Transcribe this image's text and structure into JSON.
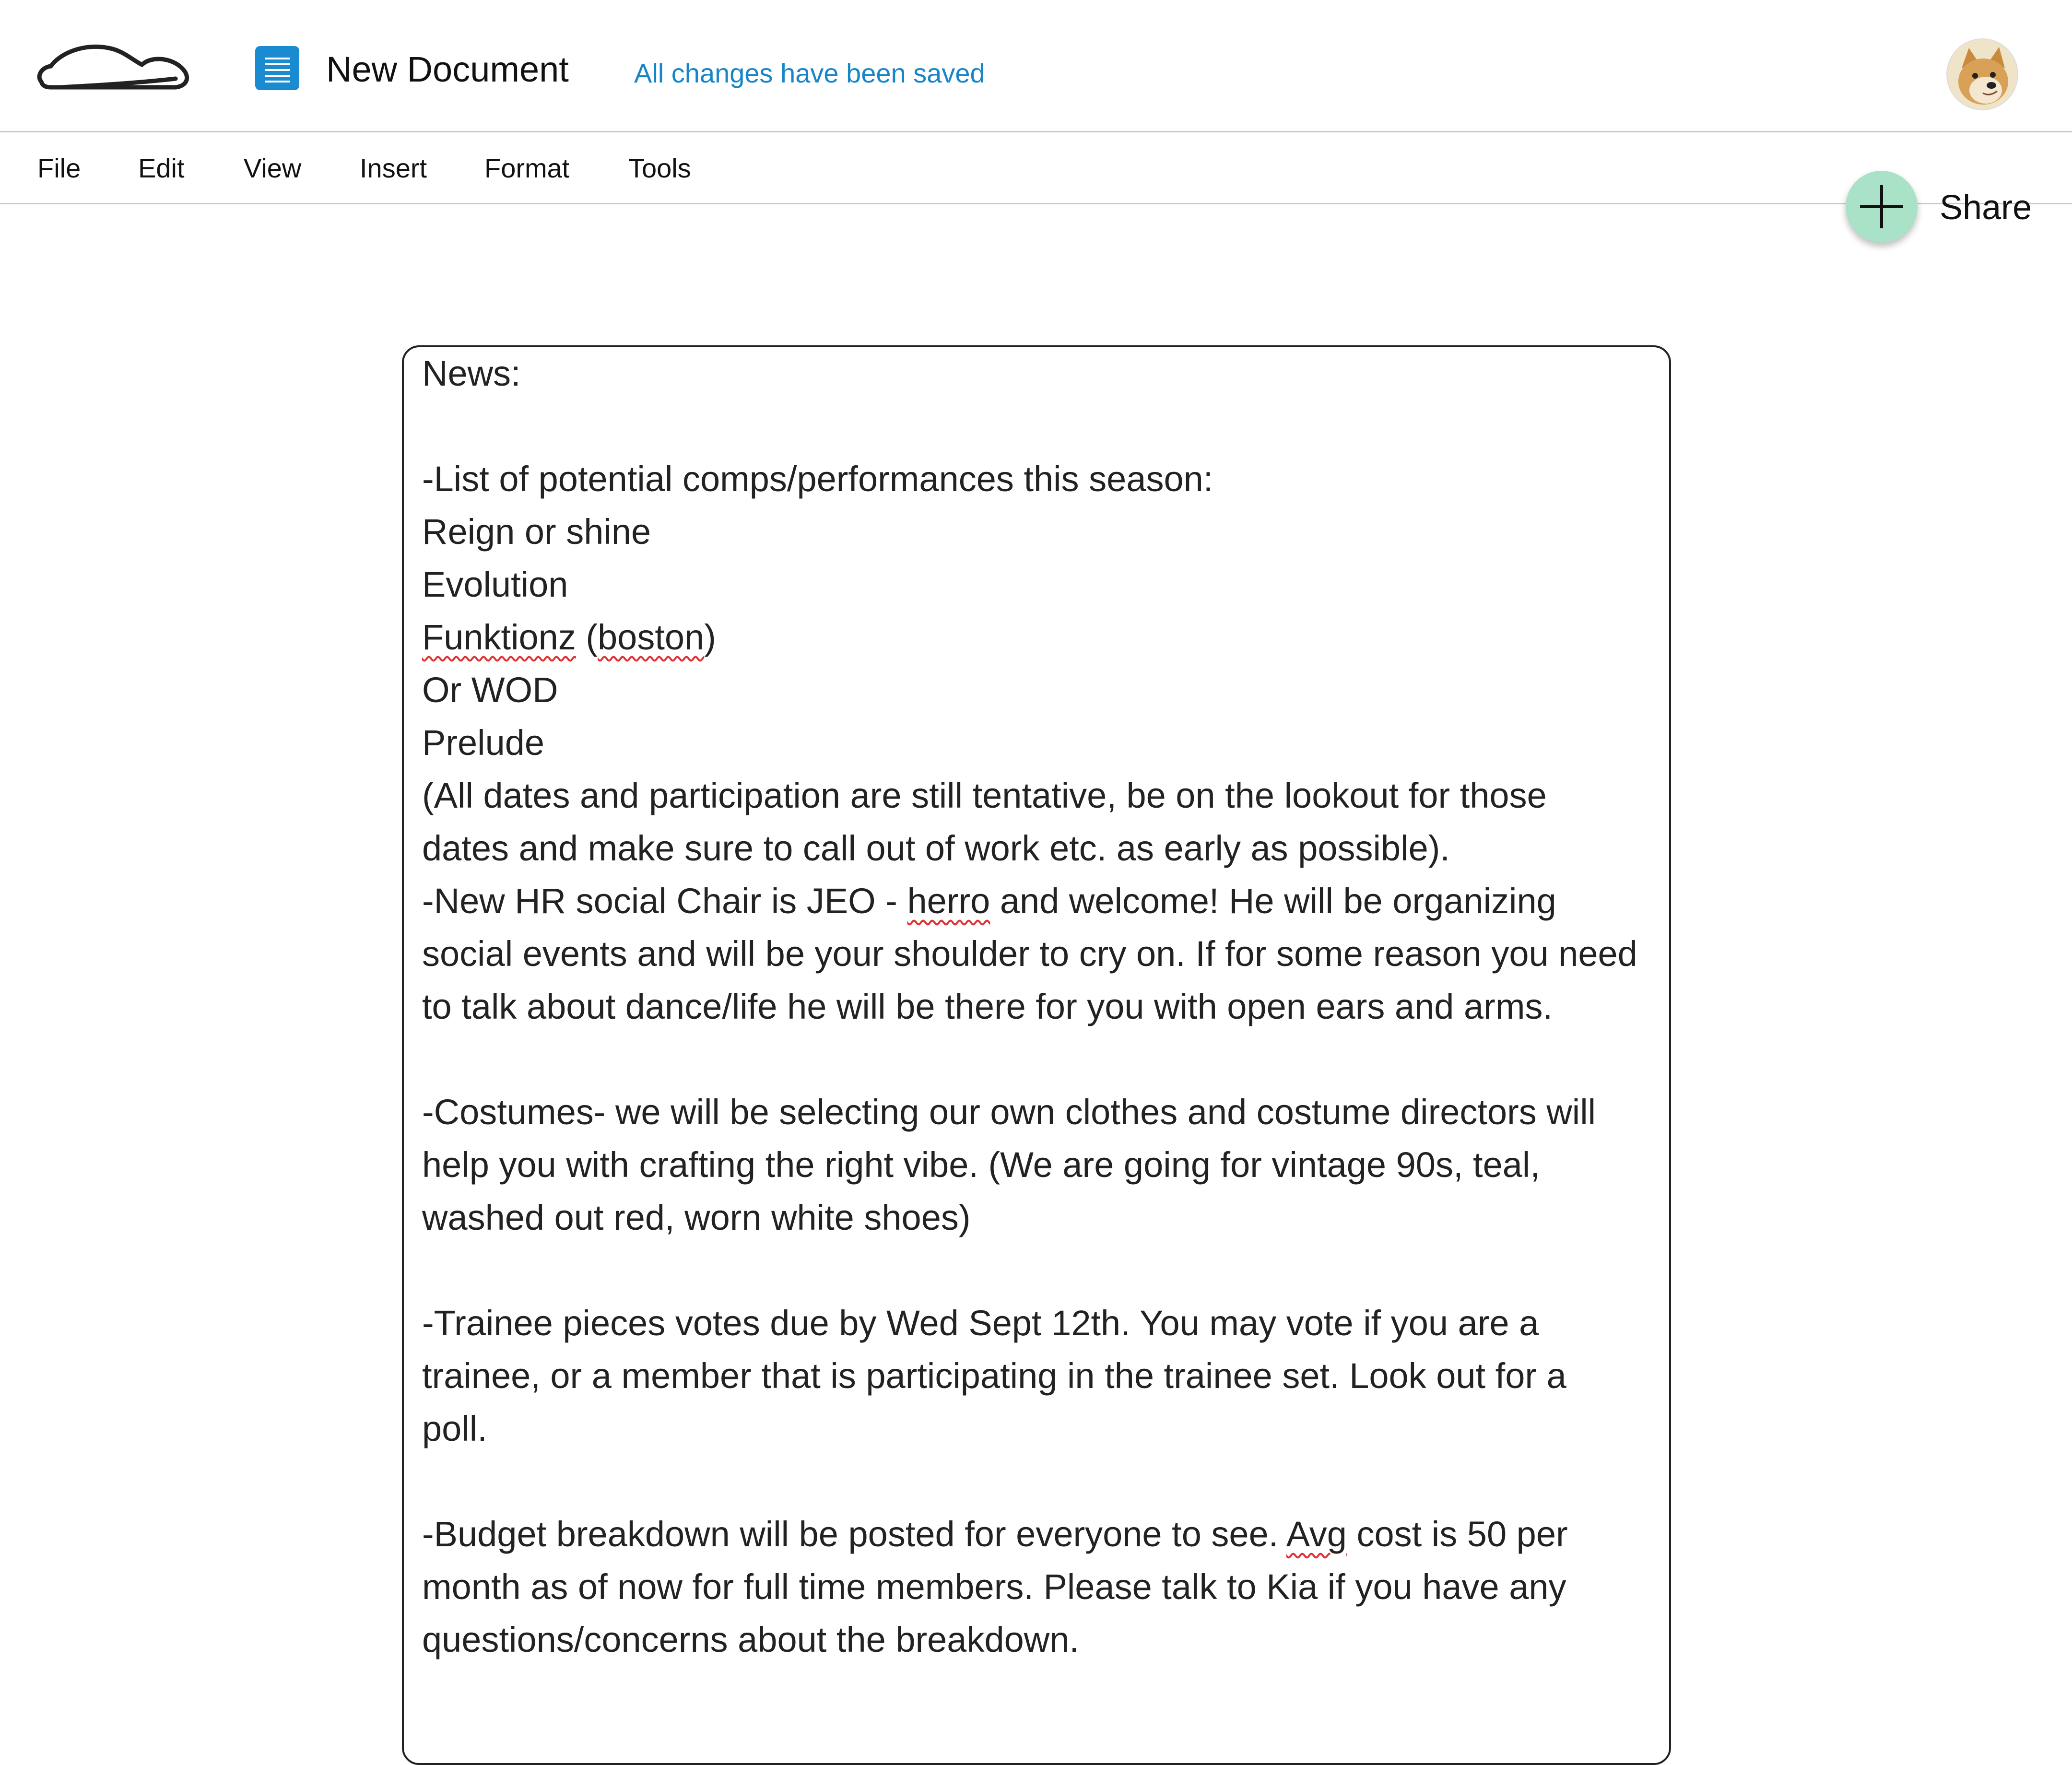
{
  "app": {
    "logo_icon": "cloud-outline-icon",
    "doc_icon": "document-icon",
    "document_title": "New Document",
    "save_status": "All changes have been saved",
    "avatar": "user-avatar-doge"
  },
  "menu": {
    "items": [
      "File",
      "Edit",
      "View",
      "Insert",
      "Format",
      "Tools"
    ]
  },
  "share": {
    "icon": "plus-icon",
    "label": "Share",
    "color": "#a9e2c7"
  },
  "colors": {
    "accent": "#1786c8",
    "doc_icon": "#1a8bd1",
    "spellcheck": "#e03030"
  },
  "document": {
    "lines": [
      "News:",
      "",
      "-List of potential comps/performances this season:",
      "Reign or shine",
      "Evolution",
      "Funktionz (boston)",
      "Or WOD",
      "Prelude",
      "(All dates and participation are still tentative, be on the lookout for those",
      "dates and make sure to call out of work etc. as early as possible).",
      "-New HR social Chair is JEO - herro and welcome! He will be organizing",
      "social events and will be your shoulder to cry on. If for some reason you need",
      "to talk about dance/life he will be there for you with open ears and arms.",
      "",
      "-Costumes- we will be selecting our own clothes and costume directors will",
      "help you with crafting the right vibe. (We are going for vintage 90s, teal,",
      "washed out red, worn white shoes)",
      "",
      "-Trainee pieces votes due by Wed Sept 12th. You may vote if you are a",
      "trainee, or a member that is participating in the trainee set. Look out for a",
      "poll.",
      "",
      "-Budget breakdown will be posted for everyone to see. Avg cost is 50 per",
      "month as of now for full time members. Please talk to Kia if you have any",
      "questions/concerns about the breakdown."
    ],
    "spellcheck_words": [
      "Funktionz",
      "boston",
      "herro",
      "Avg"
    ]
  }
}
